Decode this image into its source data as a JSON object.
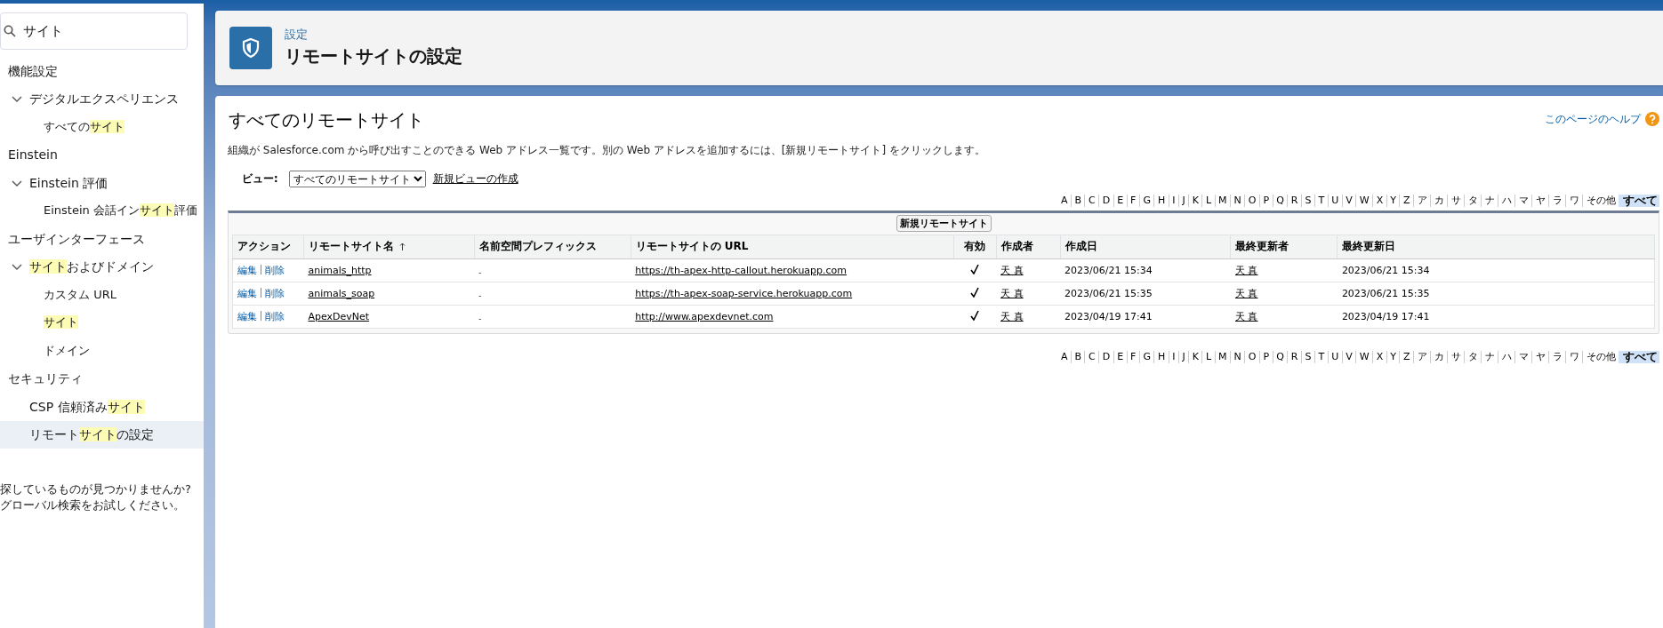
{
  "sidebar": {
    "search": {
      "value": "サイト"
    },
    "tree": [
      {
        "label": [
          {
            "text": "機能設定",
            "highlight": false
          }
        ],
        "selected": false,
        "children": [
          {
            "label": [
              {
                "text": "デジタルエクスペリエンス",
                "highlight": false
              }
            ],
            "expanded": true,
            "selected": false,
            "children": [
              {
                "label": [
                  {
                    "text": "すべての",
                    "highlight": false
                  },
                  {
                    "text": "サイト",
                    "highlight": true
                  }
                ],
                "selected": false
              }
            ]
          }
        ]
      },
      {
        "label": [
          {
            "text": "Einstein",
            "highlight": false
          }
        ],
        "selected": false,
        "children": [
          {
            "label": [
              {
                "text": "Einstein 評価",
                "highlight": false
              }
            ],
            "expanded": true,
            "selected": false,
            "children": [
              {
                "label": [
                  {
                    "text": "Einstein 会話イン",
                    "highlight": false
                  },
                  {
                    "text": "サイト",
                    "highlight": true
                  },
                  {
                    "text": "評価",
                    "highlight": false
                  }
                ],
                "selected": false
              }
            ]
          }
        ]
      },
      {
        "label": [
          {
            "text": "ユーザインターフェース",
            "highlight": false
          }
        ],
        "selected": false,
        "children": [
          {
            "label": [
              {
                "text": "サイト",
                "highlight": true
              },
              {
                "text": "およびドメイン",
                "highlight": false
              }
            ],
            "expanded": true,
            "selected": false,
            "children": [
              {
                "label": [
                  {
                    "text": "カスタム URL",
                    "highlight": false
                  }
                ],
                "selected": false
              },
              {
                "label": [
                  {
                    "text": "サイト",
                    "highlight": true
                  }
                ],
                "selected": false
              },
              {
                "label": [
                  {
                    "text": "ドメイン",
                    "highlight": false
                  }
                ],
                "selected": false
              }
            ]
          }
        ]
      },
      {
        "label": [
          {
            "text": "セキュリティ",
            "highlight": false
          }
        ],
        "selected": false,
        "children": [
          {
            "label": [
              {
                "text": "CSP 信頼済み",
                "highlight": false
              },
              {
                "text": "サイト",
                "highlight": true
              }
            ],
            "selected": false
          },
          {
            "label": [
              {
                "text": "リモート",
                "highlight": false
              },
              {
                "text": "サイト",
                "highlight": true
              },
              {
                "text": "の設定",
                "highlight": false
              }
            ],
            "selected": true
          }
        ]
      }
    ],
    "help_lines": [
      "探しているものが見つかりませんか?",
      "グローバル検索をお試しください。"
    ]
  },
  "header": {
    "breadcrumb": "設定",
    "title": "リモートサイトの設定"
  },
  "content": {
    "title": "すべてのリモートサイト",
    "help_link": "このページのヘルプ",
    "description": "組織が Salesforce.com から呼び出すことのできる Web アドレス一覧です。別の Web アドレスを追加するには、[新規リモートサイト] をクリックします。",
    "view": {
      "label": "ビュー:",
      "value": "すべてのリモートサイト",
      "create_link": "新規ビューの作成"
    },
    "alphabet_top": [
      {
        "label": "A",
        "selected": false
      },
      {
        "label": "B",
        "selected": false
      },
      {
        "label": "C",
        "selected": false
      },
      {
        "label": "D",
        "selected": false
      },
      {
        "label": "E",
        "selected": false
      },
      {
        "label": "F",
        "selected": false
      },
      {
        "label": "G",
        "selected": false
      },
      {
        "label": "H",
        "selected": false
      },
      {
        "label": "I",
        "selected": false
      },
      {
        "label": "J",
        "selected": false
      },
      {
        "label": "K",
        "selected": false
      },
      {
        "label": "L",
        "selected": false
      },
      {
        "label": "M",
        "selected": false
      },
      {
        "label": "N",
        "selected": false
      },
      {
        "label": "O",
        "selected": false
      },
      {
        "label": "P",
        "selected": false
      },
      {
        "label": "Q",
        "selected": false
      },
      {
        "label": "R",
        "selected": false
      },
      {
        "label": "S",
        "selected": false
      },
      {
        "label": "T",
        "selected": false
      },
      {
        "label": "U",
        "selected": false
      },
      {
        "label": "V",
        "selected": false
      },
      {
        "label": "W",
        "selected": false
      },
      {
        "label": "X",
        "selected": false
      },
      {
        "label": "Y",
        "selected": false
      },
      {
        "label": "Z",
        "selected": false
      },
      {
        "label": "ア",
        "selected": false
      },
      {
        "label": "カ",
        "selected": false
      },
      {
        "label": "サ",
        "selected": false
      },
      {
        "label": "タ",
        "selected": false
      },
      {
        "label": "ナ",
        "selected": false
      },
      {
        "label": "ハ",
        "selected": false
      },
      {
        "label": "マ",
        "selected": false
      },
      {
        "label": "ヤ",
        "selected": false
      },
      {
        "label": "ラ",
        "selected": false
      },
      {
        "label": "ワ",
        "selected": false
      },
      {
        "label": "その他",
        "selected": false
      },
      {
        "label": "すべて",
        "selected": true
      }
    ],
    "new_button": "新規リモートサイト",
    "table": {
      "columns": [
        {
          "label": "アクション",
          "sorted": false
        },
        {
          "label": "リモートサイト名",
          "sorted": true
        },
        {
          "label": "名前空間プレフィックス",
          "sorted": false
        },
        {
          "label": "リモートサイトの URL",
          "sorted": false
        },
        {
          "label": "有効",
          "sorted": false
        },
        {
          "label": "作成者",
          "sorted": false
        },
        {
          "label": "作成日",
          "sorted": false
        },
        {
          "label": "最終更新者",
          "sorted": false
        },
        {
          "label": "最終更新日",
          "sorted": false
        }
      ],
      "rows": [
        {
          "edit": "編集",
          "delete": "削除",
          "name": "animals_http",
          "prefix": "-",
          "url": "https://th-apex-http-callout.herokuapp.com",
          "active": true,
          "created_by": "天 真",
          "created": "2023/06/21 15:34",
          "modified_by": "天 真",
          "modified": "2023/06/21 15:34"
        },
        {
          "edit": "編集",
          "delete": "削除",
          "name": "animals_soap",
          "prefix": "-",
          "url": "https://th-apex-soap-service.herokuapp.com",
          "active": true,
          "created_by": "天 真",
          "created": "2023/06/21 15:35",
          "modified_by": "天 真",
          "modified": "2023/06/21 15:35"
        },
        {
          "edit": "編集",
          "delete": "削除",
          "name": "ApexDevNet",
          "prefix": "-",
          "url": "http://www.apexdevnet.com",
          "active": true,
          "created_by": "天 真",
          "created": "2023/04/19 17:41",
          "modified_by": "天 真",
          "modified": "2023/04/19 17:41"
        }
      ]
    },
    "alphabet_bottom": [
      {
        "label": "A",
        "selected": false
      },
      {
        "label": "B",
        "selected": false
      },
      {
        "label": "C",
        "selected": false
      },
      {
        "label": "D",
        "selected": false
      },
      {
        "label": "E",
        "selected": false
      },
      {
        "label": "F",
        "selected": false
      },
      {
        "label": "G",
        "selected": false
      },
      {
        "label": "H",
        "selected": false
      },
      {
        "label": "I",
        "selected": false
      },
      {
        "label": "J",
        "selected": false
      },
      {
        "label": "K",
        "selected": false
      },
      {
        "label": "L",
        "selected": false
      },
      {
        "label": "M",
        "selected": false
      },
      {
        "label": "N",
        "selected": false
      },
      {
        "label": "O",
        "selected": false
      },
      {
        "label": "P",
        "selected": false
      },
      {
        "label": "Q",
        "selected": false
      },
      {
        "label": "R",
        "selected": false
      },
      {
        "label": "S",
        "selected": false
      },
      {
        "label": "T",
        "selected": false
      },
      {
        "label": "U",
        "selected": false
      },
      {
        "label": "V",
        "selected": false
      },
      {
        "label": "W",
        "selected": false
      },
      {
        "label": "X",
        "selected": false
      },
      {
        "label": "Y",
        "selected": false
      },
      {
        "label": "Z",
        "selected": false
      },
      {
        "label": "ア",
        "selected": false
      },
      {
        "label": "カ",
        "selected": false
      },
      {
        "label": "サ",
        "selected": false
      },
      {
        "label": "タ",
        "selected": false
      },
      {
        "label": "ナ",
        "selected": false
      },
      {
        "label": "ハ",
        "selected": false
      },
      {
        "label": "マ",
        "selected": false
      },
      {
        "label": "ヤ",
        "selected": false
      },
      {
        "label": "ラ",
        "selected": false
      },
      {
        "label": "ワ",
        "selected": false
      },
      {
        "label": "その他",
        "selected": false
      },
      {
        "label": "すべて",
        "selected": true
      }
    ]
  }
}
